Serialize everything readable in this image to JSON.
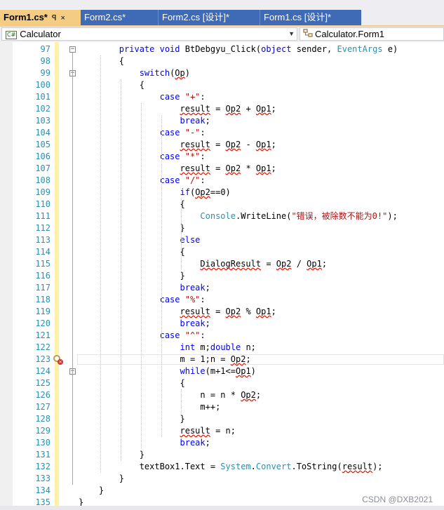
{
  "tabs": [
    {
      "label": "Form1.cs*",
      "active": true,
      "pin": "ꟼ",
      "close": "×"
    },
    {
      "label": "Form2.cs*",
      "active": false
    },
    {
      "label": "Form2.cs [设计]*",
      "active": false
    },
    {
      "label": "Form1.cs [设计]*",
      "active": false
    }
  ],
  "navbar": {
    "project_badge": "C#",
    "project": "Calculator",
    "member": "Calculator.Form1",
    "dropdown_arrow": "▼"
  },
  "lines": [
    {
      "n": "97",
      "text": "        private void BtDebgyu_Click(object sender, EventArgs e)"
    },
    {
      "n": "98",
      "text": "        {"
    },
    {
      "n": "99",
      "text": "            switch(Op)"
    },
    {
      "n": "100",
      "text": "            {"
    },
    {
      "n": "101",
      "text": "                case \"+\":"
    },
    {
      "n": "102",
      "text": "                    result = Op2 + Op1;"
    },
    {
      "n": "103",
      "text": "                    break;"
    },
    {
      "n": "104",
      "text": "                case \"-\":"
    },
    {
      "n": "105",
      "text": "                    result = Op2 - Op1;"
    },
    {
      "n": "106",
      "text": "                case \"*\":"
    },
    {
      "n": "107",
      "text": "                    result = Op2 * Op1;"
    },
    {
      "n": "108",
      "text": "                case \"/\":"
    },
    {
      "n": "109",
      "text": "                    if(Op2==0)"
    },
    {
      "n": "110",
      "text": "                    {"
    },
    {
      "n": "111",
      "text": "                        Console.WriteLine(\"错误，被除数不能为0!\");"
    },
    {
      "n": "112",
      "text": "                    }"
    },
    {
      "n": "113",
      "text": "                    else"
    },
    {
      "n": "114",
      "text": "                    {"
    },
    {
      "n": "115",
      "text": "                        DialogResult = Op2 / Op1;"
    },
    {
      "n": "116",
      "text": "                    }"
    },
    {
      "n": "117",
      "text": "                    break;"
    },
    {
      "n": "118",
      "text": "                case \"%\":"
    },
    {
      "n": "119",
      "text": "                    result = Op2 % Op1;"
    },
    {
      "n": "120",
      "text": "                    break;"
    },
    {
      "n": "121",
      "text": "                case \"^\":"
    },
    {
      "n": "122",
      "text": "                    int m;double n;"
    },
    {
      "n": "123",
      "text": "                    m = 1;n = Op2;"
    },
    {
      "n": "124",
      "text": "                    while(m+1<=Op1)"
    },
    {
      "n": "125",
      "text": "                    {"
    },
    {
      "n": "126",
      "text": "                        n = n * Op2;"
    },
    {
      "n": "127",
      "text": "                        m++;"
    },
    {
      "n": "128",
      "text": "                    }"
    },
    {
      "n": "129",
      "text": "                    result = n;"
    },
    {
      "n": "130",
      "text": "                    break;"
    },
    {
      "n": "131",
      "text": "            }"
    },
    {
      "n": "132",
      "text": "            textBox1.Text = System.Convert.ToString(result);"
    },
    {
      "n": "133",
      "text": "        }"
    },
    {
      "n": "134",
      "text": "    }"
    },
    {
      "n": "135",
      "text": "}"
    }
  ],
  "current_line": "123",
  "breakpoint_line": "123",
  "fold_lines": {
    "97": "−",
    "99": "−",
    "124": "−"
  },
  "watermark": "CSDN @DXB2021",
  "colors": {
    "keyword": "#0000ff",
    "type": "#2b91af",
    "string": "#a31515",
    "line_number": "#2b91af",
    "squiggle": "#e51400",
    "active_tab": "#f5cc84",
    "tab_strip": "#3f6ab6"
  }
}
